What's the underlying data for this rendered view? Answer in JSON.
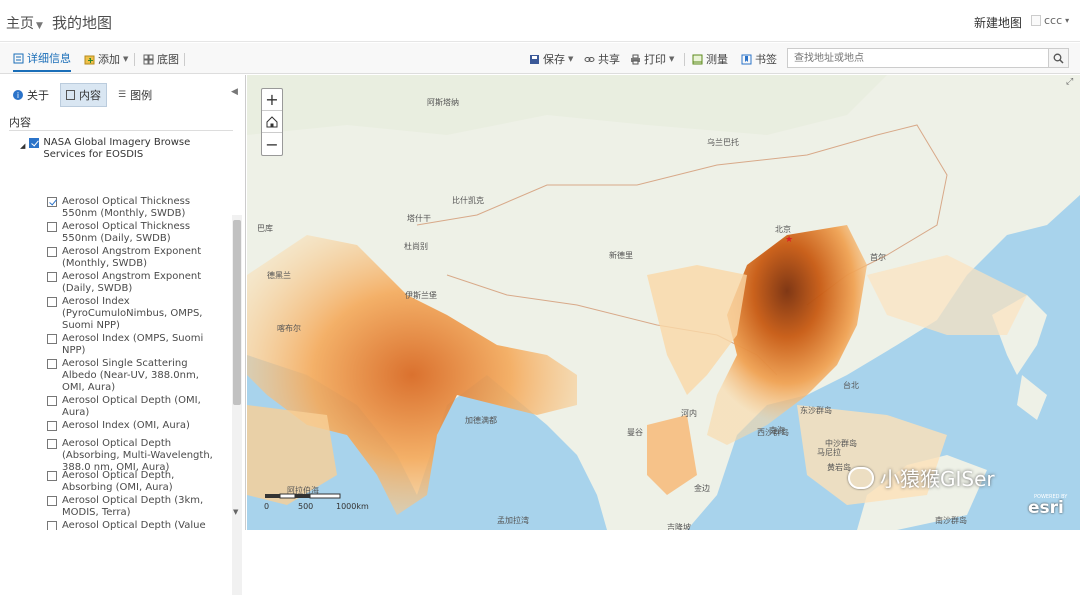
{
  "header": {
    "home": "主页",
    "map_title": "我的地图",
    "new_map": "新建地图",
    "user": "ccc"
  },
  "toolbar": {
    "details": "详细信息",
    "add": "添加",
    "basemap": "底图",
    "save": "保存",
    "share": "共享",
    "print": "打印",
    "measure": "测量",
    "bookmarks": "书签",
    "search_placeholder": "查找地址或地点"
  },
  "panel": {
    "tab_about": "关于",
    "tab_content": "内容",
    "tab_legend": "图例",
    "content_label": "内容",
    "group": "NASA Global Imagery Browse Services for EOSDIS",
    "layers": [
      {
        "label": "Aerosol Optical Thickness 550nm (Monthly, SWDB)",
        "checked": true
      },
      {
        "label": "Aerosol Optical Thickness 550nm (Daily, SWDB)",
        "checked": false
      },
      {
        "label": "Aerosol Angstrom Exponent (Monthly, SWDB)",
        "checked": false
      },
      {
        "label": "Aerosol Angstrom Exponent (Daily, SWDB)",
        "checked": false
      },
      {
        "label": "Aerosol Index (PyroCumuloNimbus, OMPS, Suomi NPP)",
        "checked": false
      },
      {
        "label": "Aerosol Index (OMPS, Suomi NPP)",
        "checked": false
      },
      {
        "label": "Aerosol Single Scattering Albedo (Near-UV, 388.0nm, OMI, Aura)",
        "checked": false
      },
      {
        "label": "Aerosol Optical Depth (OMI, Aura)",
        "checked": false
      },
      {
        "label": "Aerosol Index (OMI, Aura)",
        "checked": false
      },
      {
        "label": "Aerosol Optical Depth (Absorbing, Multi-Wavelength, 388.0 nm, OMI, Aura)",
        "checked": false
      },
      {
        "label": "Aerosol Optical Depth, Absorbing (OMI, Aura)",
        "checked": false
      },
      {
        "label": "Aerosol Optical Depth (3km, MODIS, Terra)",
        "checked": false
      },
      {
        "label": "Aerosol Optical Depth (Value Added, MODIS Combined Value...",
        "checked": false
      }
    ]
  },
  "map": {
    "labels": [
      "阿斯塔纳",
      "乌兰巴托",
      "比什凯克",
      "塔什干",
      "杜尚别",
      "巴库",
      "德黑兰",
      "喀布尔",
      "伊斯兰堡",
      "北京",
      "首尔",
      "加德满都",
      "河内",
      "曼谷",
      "金边",
      "吉隆坡",
      "马尼拉",
      "台北",
      "西沙群岛",
      "南海",
      "东沙群岛",
      "黄岩岛",
      "中沙群岛",
      "南沙群岛",
      "孟加拉湾",
      "阿拉伯海",
      "新德里"
    ],
    "scale": {
      "l0": "0",
      "l1": "500",
      "l2": "1000km"
    }
  },
  "watermark": {
    "text": "小猿猴GISer",
    "brand": "esri",
    "powered": "POWERED BY"
  }
}
